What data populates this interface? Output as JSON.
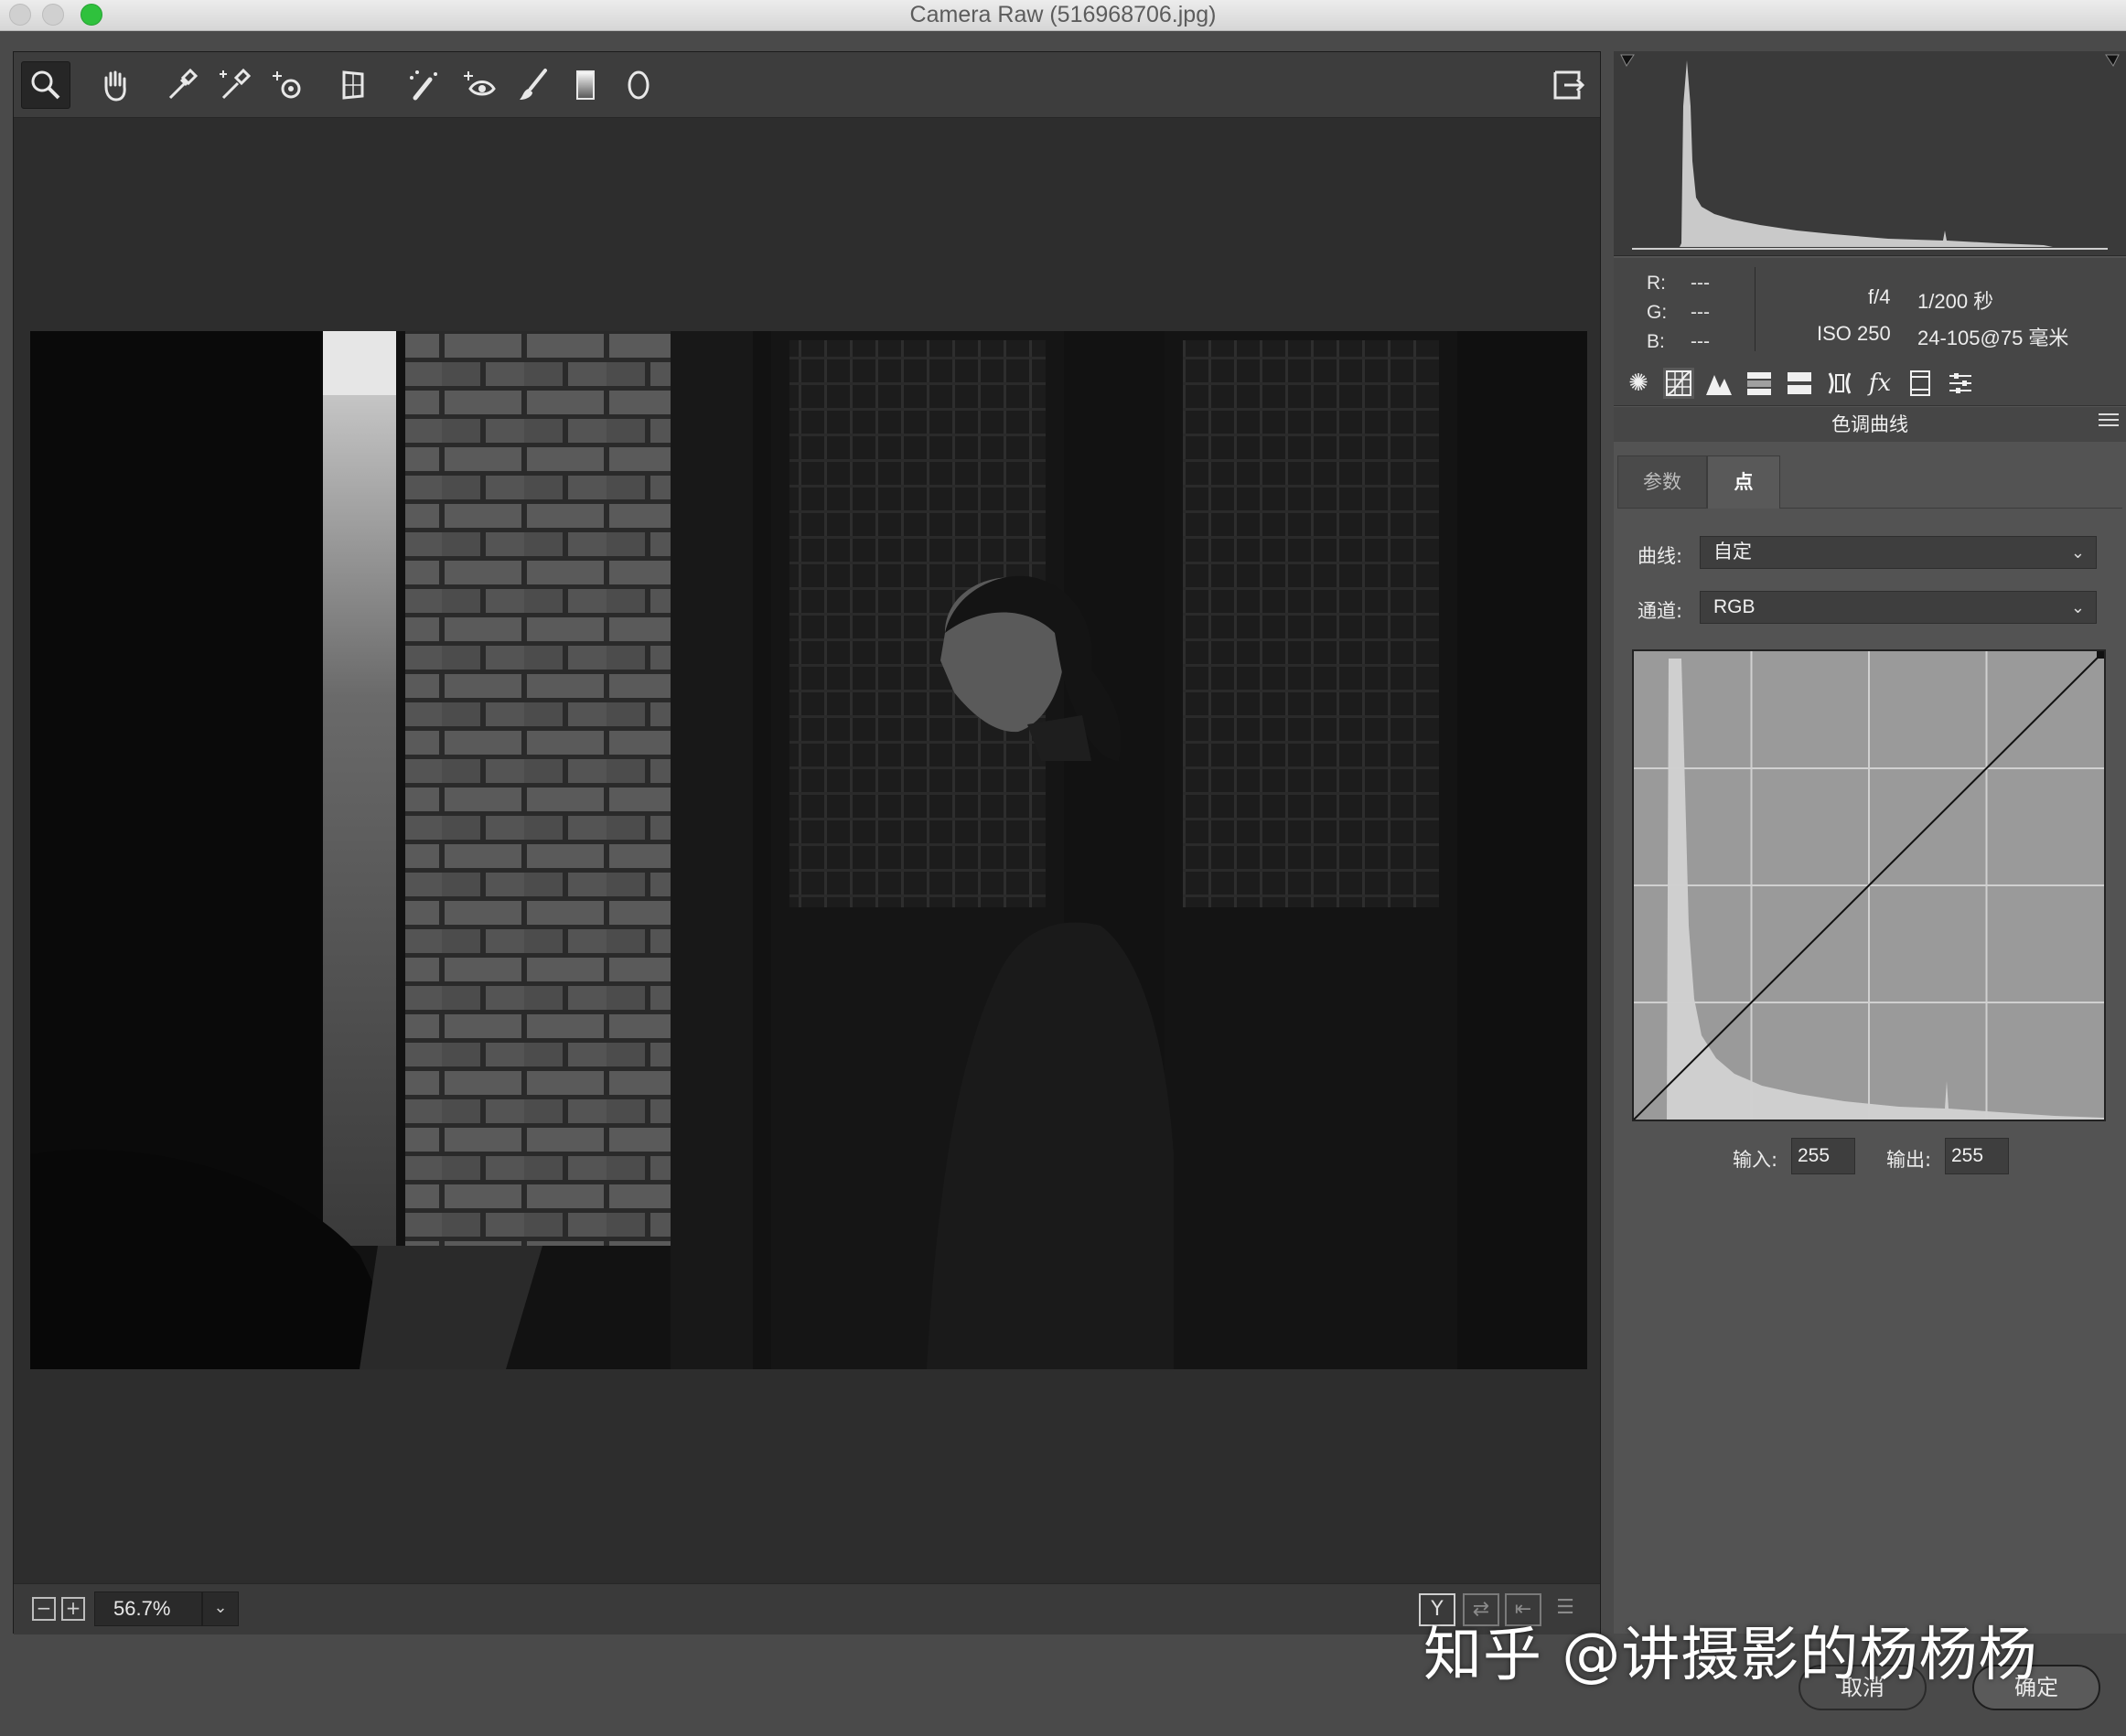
{
  "window": {
    "title": "Camera Raw (516968706.jpg)"
  },
  "toolbar": {
    "tools": [
      "zoom-tool",
      "hand-tool",
      "white-balance-tool",
      "color-sampler-tool",
      "targeted-adjustment-tool",
      "transform-tool",
      "spot-removal-tool",
      "red-eye-tool",
      "adjustment-brush",
      "graduated-filter",
      "radial-filter"
    ],
    "active_tool": "zoom-tool"
  },
  "zoom": {
    "value": "56.7%"
  },
  "readout": {
    "r_label": "R:",
    "g_label": "G:",
    "b_label": "B:",
    "r": "---",
    "g": "---",
    "b": "---"
  },
  "exif": {
    "aperture": "f/4",
    "shutter": "1/200 秒",
    "iso": "ISO 250",
    "lens": "24-105@75 毫米"
  },
  "panel": {
    "section_title": "色调曲线",
    "tabs": {
      "parametric": "参数",
      "point": "点"
    },
    "curve_label": "曲线:",
    "curve_value": "自定",
    "channel_label": "通道:",
    "channel_value": "RGB",
    "input_label": "输入:",
    "input_value": "255",
    "output_label": "输出:",
    "output_value": "255"
  },
  "buttons": {
    "cancel": "取消",
    "ok": "确定"
  },
  "watermark": "知乎 @讲摄影的杨杨杨",
  "colors": {
    "traffic_green": "#2fc13d",
    "panel_bg": "#535353",
    "canvas_bg": "#2d2d2d"
  }
}
